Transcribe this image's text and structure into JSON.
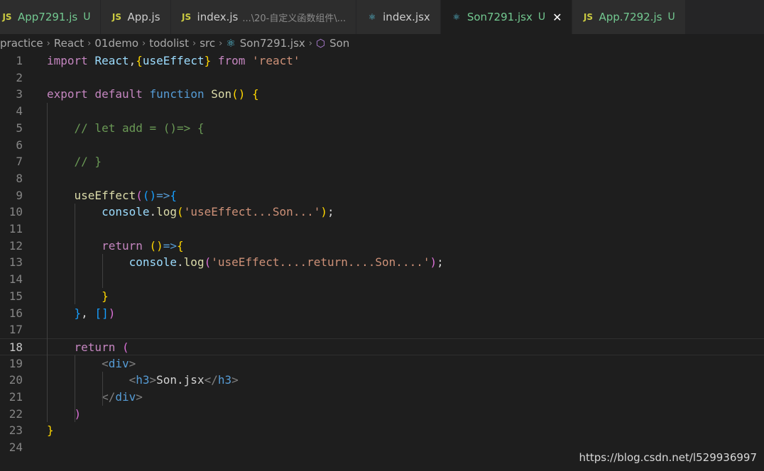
{
  "tabs": [
    {
      "icon": "JS",
      "name": "App7291.js",
      "description": "",
      "status": "U",
      "active": false
    },
    {
      "icon": "JS",
      "name": "App.js",
      "description": "",
      "status": "",
      "active": false
    },
    {
      "icon": "JS",
      "name": "index.js",
      "description": "...\\20-自定义函数组件\\...",
      "status": "",
      "active": false
    },
    {
      "icon": "⚛",
      "name": "index.jsx",
      "description": "",
      "status": "",
      "active": false
    },
    {
      "icon": "⚛",
      "name": "Son7291.jsx",
      "description": "",
      "status": "U",
      "active": true
    },
    {
      "icon": "JS",
      "name": "App.7292.js",
      "description": "",
      "status": "U",
      "active": false
    }
  ],
  "close_glyph": "✕",
  "breadcrumb": [
    "practice",
    "React",
    "01demo",
    "todolist",
    "src",
    "Son7291.jsx",
    "Son"
  ],
  "breadcrumb_sep": "›",
  "current_line": 18,
  "watermark": "https://blog.csdn.net/l529936997",
  "code_lines": [
    {
      "n": "1",
      "tokens": [
        [
          "kw",
          "import"
        ],
        [
          "plain",
          " "
        ],
        [
          "var",
          "React"
        ],
        [
          "plain",
          ","
        ],
        [
          "b1",
          "{"
        ],
        [
          "var",
          "useEffect"
        ],
        [
          "b1",
          "}"
        ],
        [
          "plain",
          " "
        ],
        [
          "kw",
          "from"
        ],
        [
          "plain",
          " "
        ],
        [
          "str",
          "'react'"
        ]
      ]
    },
    {
      "n": "2",
      "tokens": []
    },
    {
      "n": "3",
      "tokens": [
        [
          "kw",
          "export"
        ],
        [
          "plain",
          " "
        ],
        [
          "kw",
          "default"
        ],
        [
          "plain",
          " "
        ],
        [
          "kw2",
          "function"
        ],
        [
          "plain",
          " "
        ],
        [
          "fn",
          "Son"
        ],
        [
          "b1",
          "()"
        ],
        [
          "plain",
          " "
        ],
        [
          "b1",
          "{"
        ]
      ]
    },
    {
      "n": "4",
      "tokens": []
    },
    {
      "n": "5",
      "tokens": [
        [
          "plain",
          "    "
        ],
        [
          "cmt",
          "// let add = ()=> {"
        ]
      ]
    },
    {
      "n": "6",
      "tokens": []
    },
    {
      "n": "7",
      "tokens": [
        [
          "plain",
          "    "
        ],
        [
          "cmt",
          "// }"
        ]
      ]
    },
    {
      "n": "8",
      "tokens": []
    },
    {
      "n": "9",
      "tokens": [
        [
          "plain",
          "    "
        ],
        [
          "fn",
          "useEffect"
        ],
        [
          "b2",
          "("
        ],
        [
          "b3",
          "()"
        ],
        [
          "kw2",
          "=>"
        ],
        [
          "b3",
          "{"
        ]
      ]
    },
    {
      "n": "10",
      "tokens": [
        [
          "plain",
          "        "
        ],
        [
          "var",
          "console"
        ],
        [
          "plain",
          "."
        ],
        [
          "fn",
          "log"
        ],
        [
          "b1",
          "("
        ],
        [
          "str",
          "'useEffect...Son...'"
        ],
        [
          "b1",
          ")"
        ],
        [
          "plain",
          ";"
        ]
      ]
    },
    {
      "n": "11",
      "tokens": []
    },
    {
      "n": "12",
      "tokens": [
        [
          "plain",
          "        "
        ],
        [
          "kw",
          "return"
        ],
        [
          "plain",
          " "
        ],
        [
          "b1",
          "()"
        ],
        [
          "kw2",
          "=>"
        ],
        [
          "b1",
          "{"
        ]
      ]
    },
    {
      "n": "13",
      "tokens": [
        [
          "plain",
          "            "
        ],
        [
          "var",
          "console"
        ],
        [
          "plain",
          "."
        ],
        [
          "fn",
          "log"
        ],
        [
          "b2",
          "("
        ],
        [
          "str",
          "'useEffect....return....Son....'"
        ],
        [
          "b2",
          ")"
        ],
        [
          "plain",
          ";"
        ]
      ]
    },
    {
      "n": "14",
      "tokens": []
    },
    {
      "n": "15",
      "tokens": [
        [
          "plain",
          "        "
        ],
        [
          "b1",
          "}"
        ]
      ]
    },
    {
      "n": "16",
      "tokens": [
        [
          "plain",
          "    "
        ],
        [
          "b3",
          "}"
        ],
        [
          "plain",
          ", "
        ],
        [
          "b3",
          "[]"
        ],
        [
          "b2",
          ")"
        ]
      ]
    },
    {
      "n": "17",
      "tokens": []
    },
    {
      "n": "18",
      "tokens": [
        [
          "plain",
          "    "
        ],
        [
          "kw",
          "return"
        ],
        [
          "plain",
          " "
        ],
        [
          "b2",
          "("
        ]
      ]
    },
    {
      "n": "19",
      "tokens": [
        [
          "plain",
          "        "
        ],
        [
          "tagb",
          "<"
        ],
        [
          "tag",
          "div"
        ],
        [
          "tagb",
          ">"
        ]
      ]
    },
    {
      "n": "20",
      "tokens": [
        [
          "plain",
          "            "
        ],
        [
          "tagb",
          "<"
        ],
        [
          "tag",
          "h3"
        ],
        [
          "tagb",
          ">"
        ],
        [
          "plain",
          "Son.jsx"
        ],
        [
          "tagb",
          "</"
        ],
        [
          "tag",
          "h3"
        ],
        [
          "tagb",
          ">"
        ]
      ]
    },
    {
      "n": "21",
      "tokens": [
        [
          "plain",
          "        "
        ],
        [
          "tagb",
          "</"
        ],
        [
          "tag",
          "div"
        ],
        [
          "tagb",
          ">"
        ]
      ]
    },
    {
      "n": "22",
      "tokens": [
        [
          "plain",
          "    "
        ],
        [
          "b2",
          ")"
        ]
      ]
    },
    {
      "n": "23",
      "tokens": [
        [
          "b1",
          "}"
        ]
      ]
    },
    {
      "n": "24",
      "tokens": []
    }
  ]
}
